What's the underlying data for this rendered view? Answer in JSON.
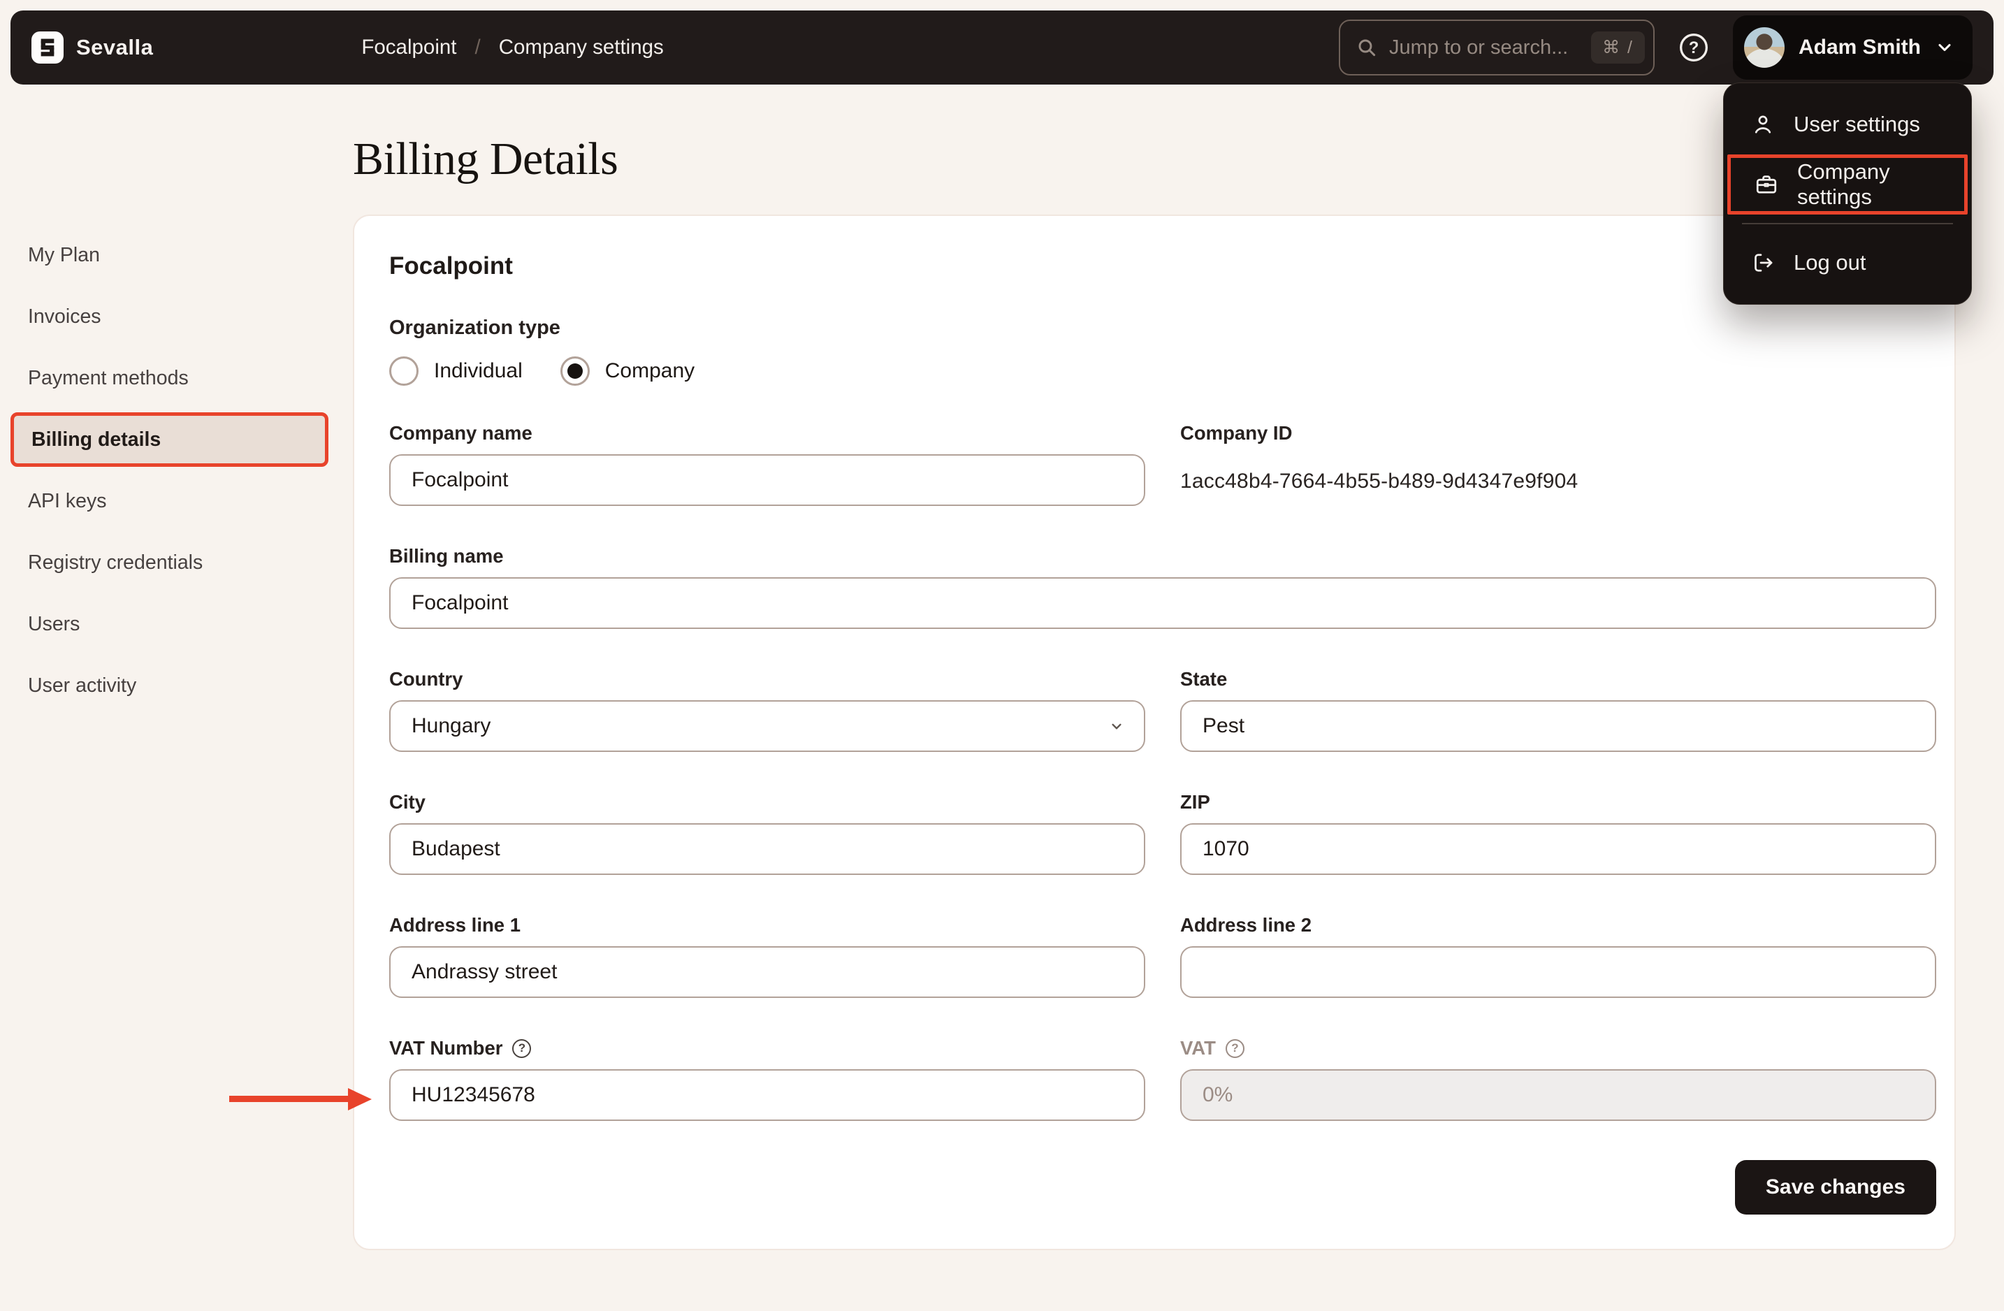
{
  "colors": {
    "annotation": "#e8432b",
    "topbar_bg": "#211b1a",
    "page_bg": "#f8f3ee",
    "card_bg": "#ffffff",
    "input_border": "#b2a299",
    "active_nav_bg": "#e9ded6",
    "save_button_bg": "#1b1514",
    "menu_bg": "#171211"
  },
  "topbar": {
    "brand": "Sevalla",
    "breadcrumb": {
      "section": "Focalpoint",
      "separator": "/",
      "page": "Company settings"
    },
    "search": {
      "placeholder": "Jump to or search...",
      "shortcut": "⌘ /"
    },
    "user": {
      "name": "Adam Smith"
    }
  },
  "user_menu": {
    "items": [
      {
        "label": "User settings"
      },
      {
        "label": "Company settings"
      },
      {
        "label": "Log out"
      }
    ]
  },
  "sidebar": {
    "items": [
      {
        "label": "My Plan"
      },
      {
        "label": "Invoices"
      },
      {
        "label": "Payment methods"
      },
      {
        "label": "Billing details"
      },
      {
        "label": "API keys"
      },
      {
        "label": "Registry credentials"
      },
      {
        "label": "Users"
      },
      {
        "label": "User activity"
      }
    ]
  },
  "page": {
    "title": "Billing Details"
  },
  "form": {
    "section_title": "Focalpoint",
    "organization_type": {
      "label": "Organization type",
      "options": [
        {
          "label": "Individual",
          "selected": false
        },
        {
          "label": "Company",
          "selected": true
        }
      ]
    },
    "fields": {
      "company_name": {
        "label": "Company name",
        "value": "Focalpoint"
      },
      "company_id": {
        "label": "Company ID",
        "value": "1acc48b4-7664-4b55-b489-9d4347e9f904"
      },
      "billing_name": {
        "label": "Billing name",
        "value": "Focalpoint"
      },
      "country": {
        "label": "Country",
        "value": "Hungary"
      },
      "state": {
        "label": "State",
        "value": "Pest"
      },
      "city": {
        "label": "City",
        "value": "Budapest"
      },
      "zip": {
        "label": "ZIP",
        "value": "1070"
      },
      "address_line_1": {
        "label": "Address line 1",
        "value": "Andrassy street"
      },
      "address_line_2": {
        "label": "Address line 2",
        "value": ""
      },
      "vat_number": {
        "label": "VAT Number",
        "value": "HU12345678"
      },
      "vat": {
        "label": "VAT",
        "value": "0%"
      }
    },
    "save_button": "Save changes"
  }
}
